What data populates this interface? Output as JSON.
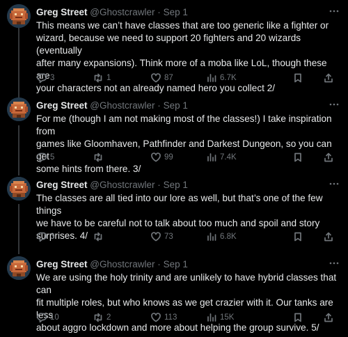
{
  "tweets": [
    {
      "name": "Greg Street",
      "handle": "@Ghostcrawler",
      "dot": "·",
      "date": "Sep 1",
      "text": "This means we can’t have classes that are too generic like a fighter or\nwizard, because we need to support 20 fighters and 20 wizards (eventually\nafter many expansions). Think more of a moba like LoL, though these are\nyour characters not an already named hero you collect 2/",
      "replies": "3",
      "retweets": "1",
      "likes": "87",
      "views": "6.7K"
    },
    {
      "name": "Greg Street",
      "handle": "@Ghostcrawler",
      "dot": "·",
      "date": "Sep 1",
      "text": "For me (though I am not making most of the classes!) I take inspiration from\ngames like Gloomhaven, Pathfinder and Darkest Dungeon, so you can get\nsome hints from there. 3/",
      "replies": "5",
      "retweets": "",
      "likes": "99",
      "views": "7.4K"
    },
    {
      "name": "Greg Street",
      "handle": "@Ghostcrawler",
      "dot": "·",
      "date": "Sep 1",
      "text": "The classes are all tied into our lore as well, but that’s one of the few things\nwe have to be careful not to talk about too much and spoil and story\nsurprises. 4/",
      "replies": "3",
      "retweets": "",
      "likes": "73",
      "views": "6.8K"
    },
    {
      "name": "Greg Street",
      "handle": "@Ghostcrawler",
      "dot": "·",
      "date": "Sep 1",
      "text": "We are using the holy trinity and are unlikely to have hybrid classes that can\nfit multiple roles, but who knows as we get crazier with it. Our tanks are less\nabout aggro lockdown and more about helping the group survive. 5/",
      "replies": "10",
      "retweets": "2",
      "likes": "113",
      "views": "15K"
    }
  ],
  "icons": {
    "avatar": "pixel-art-avatar",
    "more": "more-dots-icon",
    "reply": "reply-icon",
    "retweet": "retweet-icon",
    "like": "heart-icon",
    "views": "views-icon",
    "bookmark": "bookmark-icon",
    "share": "share-icon"
  },
  "colors": {
    "background": "#000000",
    "text": "#e7e9ea",
    "muted": "#71767b",
    "thread_line": "#333639"
  }
}
